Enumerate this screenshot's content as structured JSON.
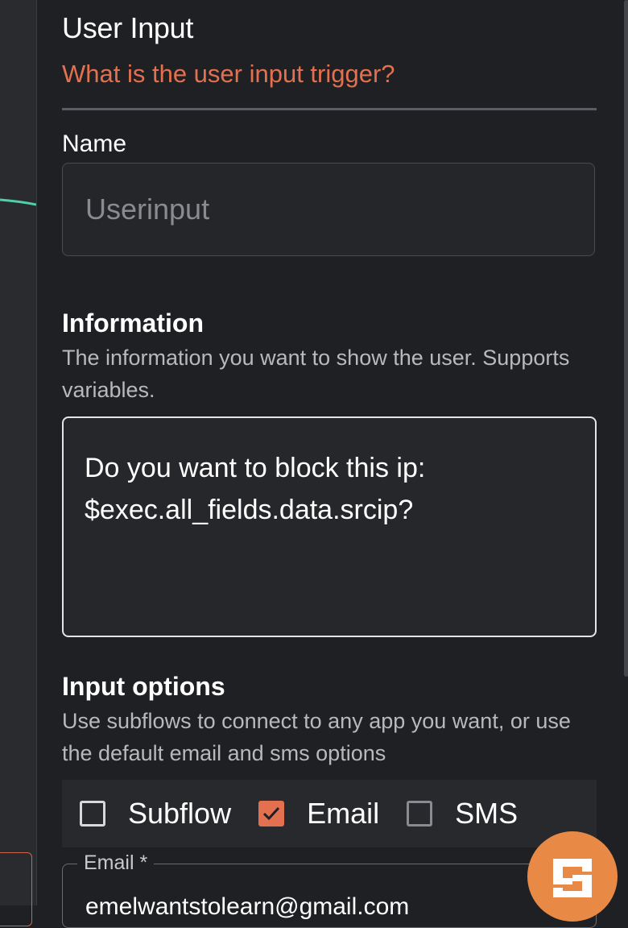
{
  "panel": {
    "title": "User Input",
    "subtitle": "What is the user input trigger?"
  },
  "name_field": {
    "label": "Name",
    "placeholder": "Userinput",
    "value": ""
  },
  "information": {
    "title": "Information",
    "description": "The information you want to show the user. Supports variables.",
    "value": "Do you want to block this ip:\n$exec.all_fields.data.srcip?"
  },
  "input_options": {
    "title": "Input options",
    "description": "Use subflows to connect to any app you want, or use the default email and sms options",
    "options": [
      {
        "label": "Subflow",
        "checked": false
      },
      {
        "label": "Email",
        "checked": true
      },
      {
        "label": "SMS",
        "checked": false
      }
    ]
  },
  "email_field": {
    "label": "Email *",
    "value": "emelwantstolearn@gmail.com"
  },
  "colors": {
    "accent": "#e3704f",
    "fab": "#e88a45",
    "background": "#1f2024"
  },
  "icons": {
    "fab": "shuffle-logo-icon",
    "check": "checkmark-icon"
  }
}
